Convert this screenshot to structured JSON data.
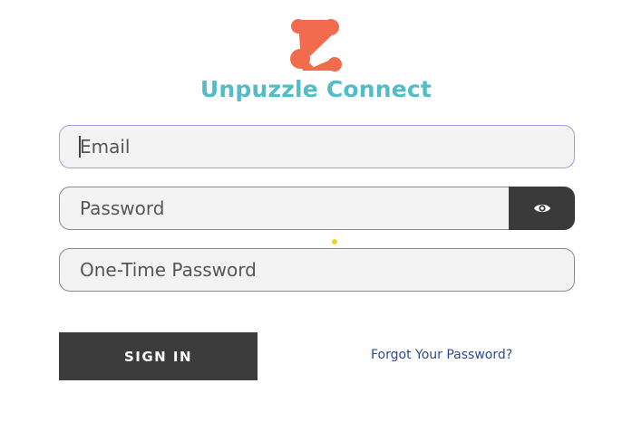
{
  "brand": {
    "logo_icon": "puzzle-link-icon",
    "name": "Unpuzzle Connect",
    "name_color": "#52bcc8",
    "logo_color": "#f26b4e"
  },
  "form": {
    "email": {
      "placeholder": "Email",
      "value": ""
    },
    "password": {
      "placeholder": "Password",
      "value": "",
      "toggle_icon": "eye-icon"
    },
    "otp": {
      "placeholder": "One-Time Password",
      "value": ""
    },
    "sign_in_label": "SIGN IN",
    "forgot_label": "Forgot Your Password?"
  }
}
